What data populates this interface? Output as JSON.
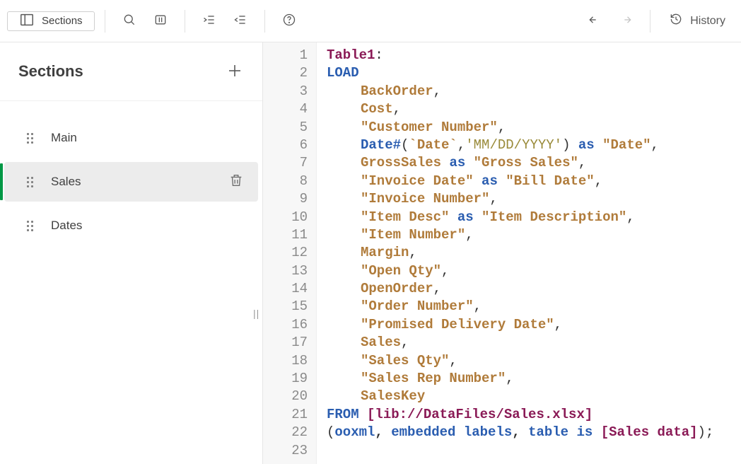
{
  "toolbar": {
    "sections_label": "Sections",
    "history_label": "History"
  },
  "sidebar": {
    "title": "Sections",
    "items": [
      {
        "label": "Main",
        "active": false
      },
      {
        "label": "Sales",
        "active": true
      },
      {
        "label": "Dates",
        "active": false
      }
    ]
  },
  "editor": {
    "line_count": 23,
    "lines": [
      [
        {
          "c": "tok-label",
          "t": "Table1"
        },
        {
          "c": "tok-punc",
          "t": ":"
        }
      ],
      [
        {
          "c": "tok-kw",
          "t": "LOAD"
        }
      ],
      [
        {
          "c": "ind1",
          "t": ""
        },
        {
          "c": "tok-id",
          "t": "BackOrder"
        },
        {
          "c": "tok-punc",
          "t": ","
        }
      ],
      [
        {
          "c": "ind1",
          "t": ""
        },
        {
          "c": "tok-id",
          "t": "Cost"
        },
        {
          "c": "tok-punc",
          "t": ","
        }
      ],
      [
        {
          "c": "ind1",
          "t": ""
        },
        {
          "c": "tok-str",
          "t": "\"Customer Number\""
        },
        {
          "c": "tok-punc",
          "t": ","
        }
      ],
      [
        {
          "c": "ind1",
          "t": ""
        },
        {
          "c": "tok-func",
          "t": "Date#"
        },
        {
          "c": "tok-punc",
          "t": "("
        },
        {
          "c": "tok-id",
          "t": "`Date`"
        },
        {
          "c": "tok-punc",
          "t": ","
        },
        {
          "c": "tok-lit",
          "t": "'MM/DD/YYYY'"
        },
        {
          "c": "tok-punc",
          "t": ") "
        },
        {
          "c": "tok-kw2",
          "t": "as"
        },
        {
          "c": "tok-punc",
          "t": " "
        },
        {
          "c": "tok-str",
          "t": "\"Date\""
        },
        {
          "c": "tok-punc",
          "t": ","
        }
      ],
      [
        {
          "c": "ind1",
          "t": ""
        },
        {
          "c": "tok-id",
          "t": "GrossSales"
        },
        {
          "c": "tok-punc",
          "t": " "
        },
        {
          "c": "tok-kw2",
          "t": "as"
        },
        {
          "c": "tok-punc",
          "t": " "
        },
        {
          "c": "tok-str",
          "t": "\"Gross Sales\""
        },
        {
          "c": "tok-punc",
          "t": ","
        }
      ],
      [
        {
          "c": "ind1",
          "t": ""
        },
        {
          "c": "tok-str",
          "t": "\"Invoice Date\""
        },
        {
          "c": "tok-punc",
          "t": " "
        },
        {
          "c": "tok-kw2",
          "t": "as"
        },
        {
          "c": "tok-punc",
          "t": " "
        },
        {
          "c": "tok-str",
          "t": "\"Bill Date\""
        },
        {
          "c": "tok-punc",
          "t": ","
        }
      ],
      [
        {
          "c": "ind1",
          "t": ""
        },
        {
          "c": "tok-str",
          "t": "\"Invoice Number\""
        },
        {
          "c": "tok-punc",
          "t": ","
        }
      ],
      [
        {
          "c": "ind1",
          "t": ""
        },
        {
          "c": "tok-str",
          "t": "\"Item Desc\""
        },
        {
          "c": "tok-punc",
          "t": " "
        },
        {
          "c": "tok-kw2",
          "t": "as"
        },
        {
          "c": "tok-punc",
          "t": " "
        },
        {
          "c": "tok-str",
          "t": "\"Item Description\""
        },
        {
          "c": "tok-punc",
          "t": ","
        }
      ],
      [
        {
          "c": "ind1",
          "t": ""
        },
        {
          "c": "tok-str",
          "t": "\"Item Number\""
        },
        {
          "c": "tok-punc",
          "t": ","
        }
      ],
      [
        {
          "c": "ind1",
          "t": ""
        },
        {
          "c": "tok-id",
          "t": "Margin"
        },
        {
          "c": "tok-punc",
          "t": ","
        }
      ],
      [
        {
          "c": "ind1",
          "t": ""
        },
        {
          "c": "tok-str",
          "t": "\"Open Qty\""
        },
        {
          "c": "tok-punc",
          "t": ","
        }
      ],
      [
        {
          "c": "ind1",
          "t": ""
        },
        {
          "c": "tok-id",
          "t": "OpenOrder"
        },
        {
          "c": "tok-punc",
          "t": ","
        }
      ],
      [
        {
          "c": "ind1",
          "t": ""
        },
        {
          "c": "tok-str",
          "t": "\"Order Number\""
        },
        {
          "c": "tok-punc",
          "t": ","
        }
      ],
      [
        {
          "c": "ind1",
          "t": ""
        },
        {
          "c": "tok-str",
          "t": "\"Promised Delivery Date\""
        },
        {
          "c": "tok-punc",
          "t": ","
        }
      ],
      [
        {
          "c": "ind1",
          "t": ""
        },
        {
          "c": "tok-id",
          "t": "Sales"
        },
        {
          "c": "tok-punc",
          "t": ","
        }
      ],
      [
        {
          "c": "ind1",
          "t": ""
        },
        {
          "c": "tok-str",
          "t": "\"Sales Qty\""
        },
        {
          "c": "tok-punc",
          "t": ","
        }
      ],
      [
        {
          "c": "ind1",
          "t": ""
        },
        {
          "c": "tok-str",
          "t": "\"Sales Rep Number\""
        },
        {
          "c": "tok-punc",
          "t": ","
        }
      ],
      [
        {
          "c": "ind1",
          "t": ""
        },
        {
          "c": "tok-id",
          "t": "SalesKey"
        }
      ],
      [
        {
          "c": "tok-kw",
          "t": "FROM"
        },
        {
          "c": "tok-punc",
          "t": " "
        },
        {
          "c": "tok-br",
          "t": "[lib://DataFiles/Sales.xlsx]"
        }
      ],
      [
        {
          "c": "tok-punc",
          "t": "("
        },
        {
          "c": "tok-kw2",
          "t": "ooxml"
        },
        {
          "c": "tok-plain",
          "t": ", "
        },
        {
          "c": "tok-kw2",
          "t": "embedded labels"
        },
        {
          "c": "tok-plain",
          "t": ", "
        },
        {
          "c": "tok-kw2",
          "t": "table is"
        },
        {
          "c": "tok-punc",
          "t": " "
        },
        {
          "c": "tok-br",
          "t": "[Sales data]"
        },
        {
          "c": "tok-punc",
          "t": ");"
        }
      ],
      [
        {
          "c": "tok-punc",
          "t": ""
        }
      ]
    ]
  }
}
